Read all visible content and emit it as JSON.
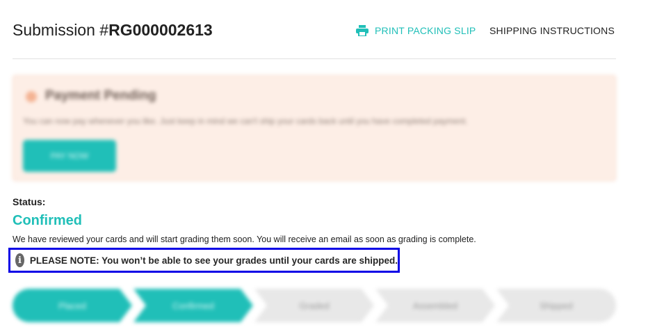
{
  "header": {
    "title_prefix": "Submission #",
    "submission_number": "RG000002613",
    "print_icon": "printer-icon",
    "print_label": "PRINT PACKING SLIP",
    "shipping_label": "SHIPPING INSTRUCTIONS",
    "accent_color": "#20bfb8"
  },
  "payment": {
    "title": "Payment Pending",
    "message": "You can now pay whenever you like. Just keep in mind we can't ship your cards back until you have completed payment.",
    "button_label": "PAY NOW",
    "icon": "warning-icon"
  },
  "status": {
    "label": "Status:",
    "value": "Confirmed",
    "description": "We have reviewed your cards and will start grading them soon. You will receive an email as soon as grading is complete."
  },
  "note": {
    "icon": "info-icon",
    "text": "PLEASE NOTE: You won’t be able to see your grades until your cards are shipped."
  },
  "stepper": {
    "steps": [
      {
        "label": "Placed",
        "state": "done"
      },
      {
        "label": "Confirmed",
        "state": "done"
      },
      {
        "label": "Graded",
        "state": "todo"
      },
      {
        "label": "Assembled",
        "state": "todo"
      },
      {
        "label": "Shipped",
        "state": "todo"
      }
    ]
  }
}
